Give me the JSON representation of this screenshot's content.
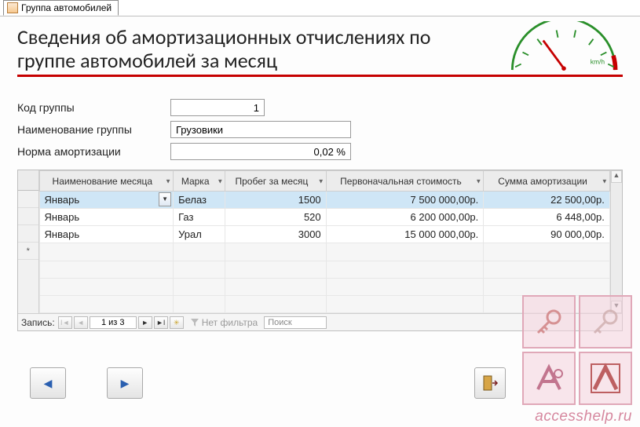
{
  "tab": {
    "label": "Группа автомобилей"
  },
  "title": "Сведения об амортизационных отчислениях по группе автомобилей за месяц",
  "gauge": {
    "unit": "km/h"
  },
  "fields": {
    "code_label": "Код группы",
    "code_value": "1",
    "name_label": "Наименование группы",
    "name_value": "Грузовики",
    "rate_label": "Норма амортизации",
    "rate_value": "0,02 %"
  },
  "grid": {
    "columns": {
      "month": "Наименование месяца",
      "brand": "Марка",
      "mileage": "Пробег за месяц",
      "cost": "Первоначальная стоимость",
      "amort": "Сумма амортизации"
    },
    "rows": [
      {
        "month": "Январь",
        "brand": "Белаз",
        "mileage": "1500",
        "cost": "7 500 000,00р.",
        "amort": "22 500,00р."
      },
      {
        "month": "Январь",
        "brand": "Газ",
        "mileage": "520",
        "cost": "6 200 000,00р.",
        "amort": "6 448,00р."
      },
      {
        "month": "Январь",
        "brand": "Урал",
        "mileage": "3000",
        "cost": "15 000 000,00р.",
        "amort": "90 000,00р."
      }
    ],
    "new_row_marker": "*"
  },
  "recnav": {
    "label": "Запись:",
    "position": "1 из 3",
    "filter": "Нет фильтра",
    "search_placeholder": "Поиск"
  },
  "watermark": {
    "text": "accesshelp.ru"
  }
}
